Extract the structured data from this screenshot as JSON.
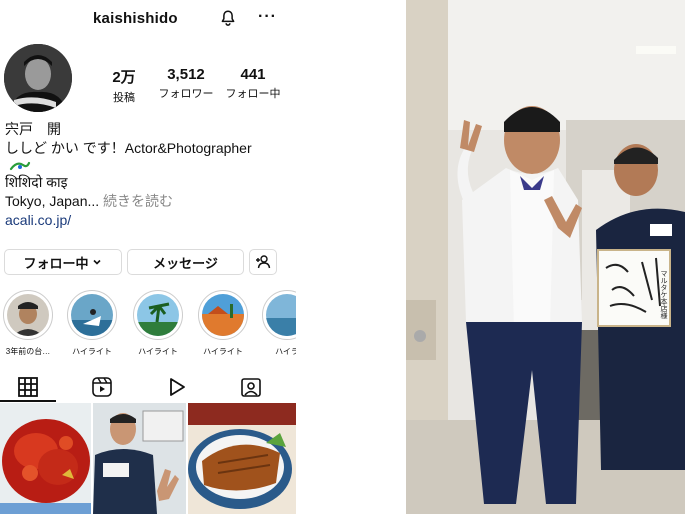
{
  "header": {
    "username": "kaishishido",
    "bell_icon": "bell-icon",
    "more_label": "···"
  },
  "stats": [
    {
      "value": "2万",
      "label": "投稿"
    },
    {
      "value": "3,512",
      "label": "フォロワー"
    },
    {
      "value": "441",
      "label": "フォロー中"
    }
  ],
  "bio": {
    "name": "宍戸　開",
    "line1": "ししど かい です！Actor&Photographer",
    "line2": "शिशिदो काइ",
    "location": "Tokyo, Japan...",
    "more": " 続きを読む",
    "link": "acali.co.jp/"
  },
  "buttons": {
    "follow": "フォロー中",
    "message": "メッセージ"
  },
  "highlights": [
    {
      "label": "3年前の台…"
    },
    {
      "label": "ハイライト"
    },
    {
      "label": "ハイライト"
    },
    {
      "label": "ハイライト"
    },
    {
      "label": "ハイラ"
    }
  ],
  "tabs": [
    "grid-icon",
    "reels-icon",
    "video-icon",
    "tagged-icon"
  ],
  "photo": {
    "shikishi_text": "マルタケ本店様"
  },
  "colors": {
    "link": "#1a3a7a",
    "border": "#dbdbdb",
    "muted": "#888888"
  }
}
